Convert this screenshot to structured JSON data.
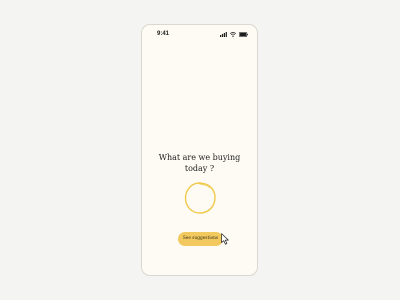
{
  "status_bar": {
    "time": "9:41",
    "icons": [
      "signal-icon",
      "wifi-icon",
      "battery-icon"
    ]
  },
  "prompt": {
    "line1": "What are we buying",
    "line2": "today ?"
  },
  "scribble": {
    "icon": "hand-drawn-circle-icon",
    "color": "#f0c94c"
  },
  "actions": {
    "suggestions_label": "See suggestions"
  },
  "colors": {
    "screen_background": "#fdfbf3",
    "button_background": "#f1c95f",
    "text": "#222222"
  }
}
